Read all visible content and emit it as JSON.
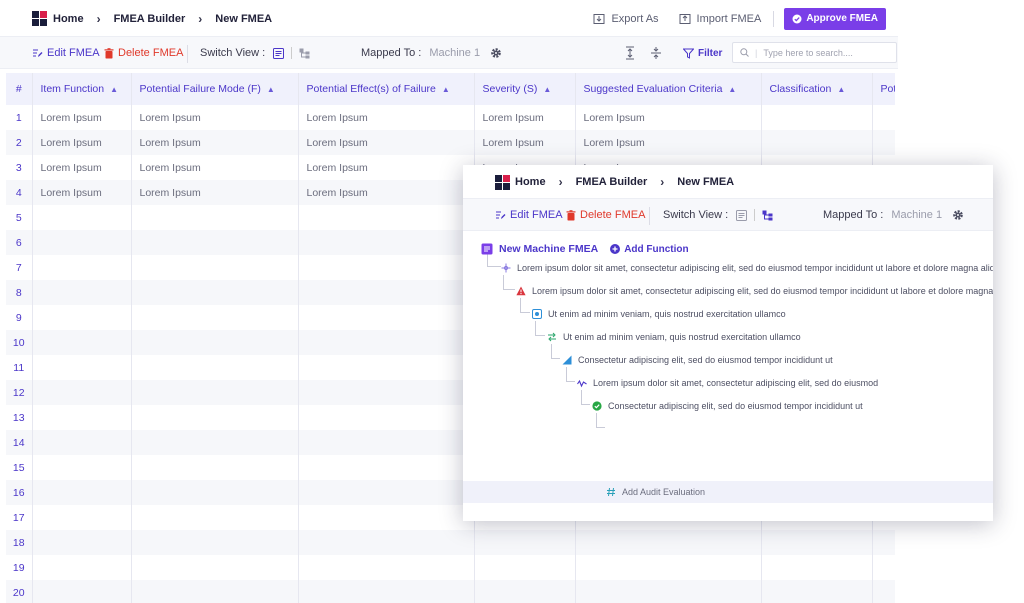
{
  "breadcrumb": [
    "Home",
    "FMEA Builder",
    "New FMEA"
  ],
  "top_actions": {
    "export_label": "Export As",
    "import_label": "Import FMEA",
    "approve_label": "Approve FMEA"
  },
  "toolbar": {
    "edit_label": "Edit FMEA",
    "delete_label": "Delete FMEA",
    "switch_view_label": "Switch View :",
    "mapped_to_label": "Mapped To :",
    "mapped_to_value": "Machine 1",
    "filter_label": "Filter",
    "search_placeholder": "Type here to search...."
  },
  "table": {
    "columns": [
      "#",
      "Item Function",
      "Potential Failure Mode (F)",
      "Potential Effect(s) of Failure",
      "Severity (S)",
      "Suggested Evaluation Criteria",
      "Classification",
      "Pote"
    ],
    "rows": [
      [
        "1",
        "Lorem Ipsum",
        "Lorem Ipsum",
        "Lorem Ipsum",
        "Lorem Ipsum",
        "Lorem Ipsum",
        "",
        ""
      ],
      [
        "2",
        "Lorem Ipsum",
        "Lorem Ipsum",
        "Lorem Ipsum",
        "Lorem Ipsum",
        "Lorem Ipsum",
        "",
        ""
      ],
      [
        "3",
        "Lorem Ipsum",
        "Lorem Ipsum",
        "Lorem Ipsum",
        "Lorem Ipsum",
        "Lorem Ipsum",
        "",
        ""
      ],
      [
        "4",
        "Lorem Ipsum",
        "Lorem Ipsum",
        "Lorem Ipsum",
        "Lorem Ipsum",
        "Lorem Ipsum",
        "",
        ""
      ],
      [
        "5",
        "",
        "",
        "",
        "",
        "",
        "",
        ""
      ],
      [
        "6",
        "",
        "",
        "",
        "",
        "",
        "",
        ""
      ],
      [
        "7",
        "",
        "",
        "",
        "",
        "",
        "",
        ""
      ],
      [
        "8",
        "",
        "",
        "",
        "",
        "",
        "",
        ""
      ],
      [
        "9",
        "",
        "",
        "",
        "",
        "",
        "",
        ""
      ],
      [
        "10",
        "",
        "",
        "",
        "",
        "",
        "",
        ""
      ],
      [
        "11",
        "",
        "",
        "",
        "",
        "",
        "",
        ""
      ],
      [
        "12",
        "",
        "",
        "",
        "",
        "",
        "",
        ""
      ],
      [
        "13",
        "",
        "",
        "",
        "",
        "",
        "",
        ""
      ],
      [
        "14",
        "",
        "",
        "",
        "",
        "",
        "",
        ""
      ],
      [
        "15",
        "",
        "",
        "",
        "",
        "",
        "",
        ""
      ],
      [
        "16",
        "",
        "",
        "",
        "",
        "",
        "",
        ""
      ],
      [
        "17",
        "",
        "",
        "",
        "",
        "",
        "",
        ""
      ],
      [
        "18",
        "",
        "",
        "",
        "",
        "",
        "",
        ""
      ],
      [
        "19",
        "",
        "",
        "",
        "",
        "",
        "",
        ""
      ],
      [
        "20",
        "",
        "",
        "",
        "",
        "",
        "",
        ""
      ]
    ]
  },
  "tree": {
    "root_label": "New Machine FMEA",
    "add_function_label": "Add Function",
    "nodes": [
      {
        "icon": "function-icon",
        "text": "Lorem ipsum dolor sit amet, consectetur adipiscing elit, sed do eiusmod tempor incididunt ut labore et dolore magna aliqua."
      },
      {
        "icon": "warning-icon",
        "text": "Lorem ipsum dolor sit amet, consectetur adipiscing elit, sed do eiusmod tempor incididunt ut labore et dolore magna aliqua."
      },
      {
        "icon": "effect-icon",
        "text": "Ut enim ad minim veniam, quis nostrud exercitation ullamco"
      },
      {
        "icon": "cause-icon",
        "text": "Ut enim ad minim veniam, quis nostrud exercitation ullamco"
      },
      {
        "icon": "control-icon",
        "text": "Consectetur adipiscing elit, sed do eiusmod tempor incididunt ut"
      },
      {
        "icon": "signal-icon",
        "text": "Lorem ipsum dolor sit amet, consectetur adipiscing elit, sed do eiusmod"
      },
      {
        "icon": "check-icon",
        "text": "Consectetur adipiscing elit, sed do eiusmod tempor incididunt ut"
      },
      {
        "icon": "hash-icon",
        "text": "Add Audit Evaluation"
      }
    ]
  },
  "colors": {
    "accent": "#4b36c9",
    "approve": "#7a3ee8",
    "delete": "#e0392b",
    "header_bg": "#f0f1fc",
    "row_alt": "#f6f7fa"
  }
}
